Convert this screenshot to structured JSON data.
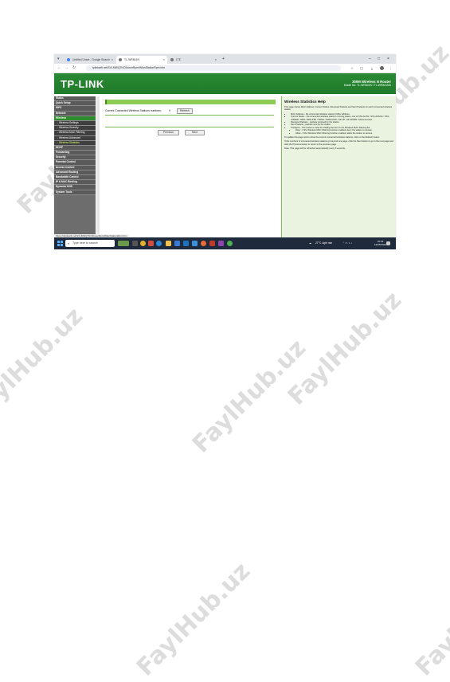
{
  "browser": {
    "tabs": [
      {
        "label": "Untitled Unset - Google Search"
      },
      {
        "label": "TL-WR841N"
      },
      {
        "label": "LTE"
      }
    ],
    "url": "tplinkwifi.net/SVLMWQ7NO3/userRpm/WlanStationRpm.htm",
    "status_url": "https://tplinkwifi.net/SVLMWQ7NO3/userRpm/WlanStationRpm.htm"
  },
  "router": {
    "logo": "TP-LINK",
    "product": "300M Wireless N Router",
    "model": "Model No. TL-WR841N / TL-WR841ND",
    "menu": [
      {
        "label": "Status",
        "style": "normal"
      },
      {
        "label": "Quick Setup",
        "style": "normal"
      },
      {
        "label": "WPS",
        "style": "normal"
      },
      {
        "label": "Network",
        "style": "normal"
      },
      {
        "label": "Wireless",
        "style": "hl"
      },
      {
        "label": "- Wireless Settings",
        "style": "sub"
      },
      {
        "label": "- Wireless Security",
        "style": "sub"
      },
      {
        "label": "- Wireless MAC Filtering",
        "style": "sub"
      },
      {
        "label": "- Wireless Advanced",
        "style": "sub"
      },
      {
        "label": "- Wireless Statistics",
        "style": "subhl"
      },
      {
        "label": "DHCP",
        "style": "normal"
      },
      {
        "label": "Forwarding",
        "style": "normal"
      },
      {
        "label": "Security",
        "style": "normal"
      },
      {
        "label": "Parental Control",
        "style": "normal"
      },
      {
        "label": "Access Control",
        "style": "normal"
      },
      {
        "label": "Advanced Routing",
        "style": "normal"
      },
      {
        "label": "Bandwidth Control",
        "style": "normal"
      },
      {
        "label": "IP & MAC Binding",
        "style": "normal"
      },
      {
        "label": "Dynamic DNS",
        "style": "normal"
      },
      {
        "label": "System Tools",
        "style": "normal"
      }
    ],
    "section_title": "Wireless Statistics",
    "station_label": "Current Connected Wireless Stations numbers:",
    "station_count": "0",
    "refresh": "Refresh",
    "previous": "Previous",
    "next": "Next"
  },
  "help": {
    "title": "Wireless Statistics Help",
    "intro": "This page shows MAC Address, Current Status, Received Packets and Sent Packets for each connected wireless station.",
    "items": [
      "MAC Address - the connected wireless station's MAC address.",
      "Current Status - the connected wireless station's running status, one of STA-AUTH / STA-ASSOC / STA-JOINED / WPA / WPA-PSK / WPA2 / WPA2-PSK / AP-UP / AP-DOWN / Disconnected.",
      "Received Packets - packets received by the station.",
      "Sent Packets - packets sent by the station.",
      "Configure - The button is used for loading the item to the Wireless MAC Filtering list.",
      "Deny - If the Wireless MAC Filtering function enabled, deny the station to access.",
      "Allow - If the Wireless MAC Filtering function enabled, allow the station to access."
    ],
    "p2": "To update this page and to show the current connected wireless stations, click on the Refresh button.",
    "p3": "If the numbers of connected wireless stations go beyond one page, click the Next button to go to the next page and click the Previous button to return to the previous page.",
    "note": "Note: This page will be refreshed automatically every 5 seconds."
  },
  "taskbar": {
    "search_placeholder": "Type here to search",
    "weather": "27°C  Light rain",
    "time": "15:43",
    "date": "12/05/2024"
  },
  "watermark": "FaylHub.uz"
}
